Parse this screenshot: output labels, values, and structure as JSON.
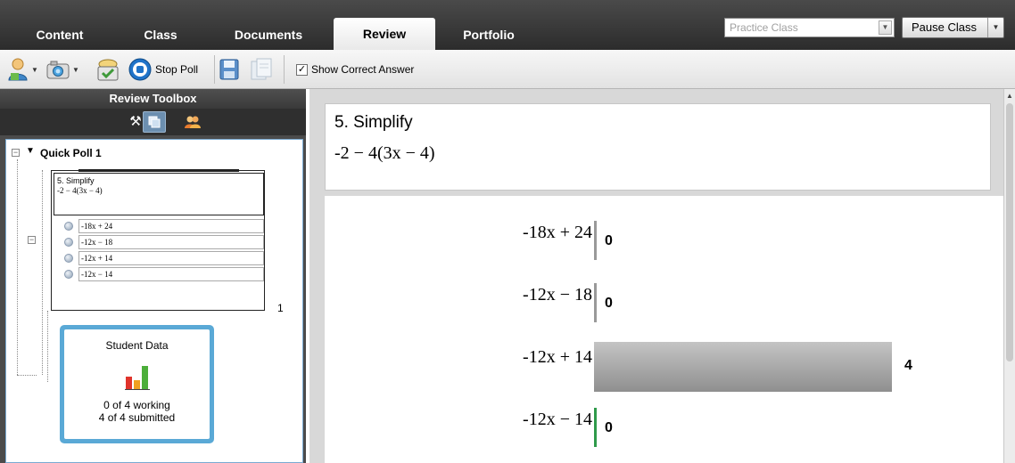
{
  "tabs": [
    {
      "label": "Content"
    },
    {
      "label": "Class"
    },
    {
      "label": "Documents"
    },
    {
      "label": "Review"
    },
    {
      "label": "Portfolio"
    }
  ],
  "active_tab": "Review",
  "class_select": {
    "value": "Practice Class"
  },
  "pause_button": {
    "label": "Pause Class"
  },
  "toolbar": {
    "stop_poll_label": "Stop Poll",
    "show_correct_answer_label": "Show Correct Answer",
    "show_correct_answer_checked": true
  },
  "left_panel": {
    "title": "Review Toolbox",
    "poll_title": "Quick Poll 1",
    "thumb_title": "5. Simplify",
    "thumb_expr": "-2 − 4(3x − 4)",
    "thumb_answers": [
      "-18x + 24",
      "-12x − 18",
      "-12x + 14",
      "-12x − 14"
    ],
    "thumb_count": "1",
    "student_card": {
      "title": "Student Data",
      "working": "0 of 4 working",
      "submitted": "4 of 4 submitted"
    }
  },
  "question": {
    "title": "5. Simplify",
    "expression": "-2 − 4(3x − 4)"
  },
  "results": {
    "max_count": 4,
    "answers": [
      {
        "label": "-18x + 24",
        "count": "0",
        "value": 0,
        "correct": false
      },
      {
        "label": "-12x − 18",
        "count": "0",
        "value": 0,
        "correct": false
      },
      {
        "label": "-12x + 14",
        "count": "4",
        "value": 4,
        "correct": false
      },
      {
        "label": "-12x − 14",
        "count": "0",
        "value": 0,
        "correct": true
      }
    ]
  },
  "colors": {
    "correct_answer": "#2f9a4a",
    "bar": "#999999",
    "card_border": "#5aa9d6"
  }
}
